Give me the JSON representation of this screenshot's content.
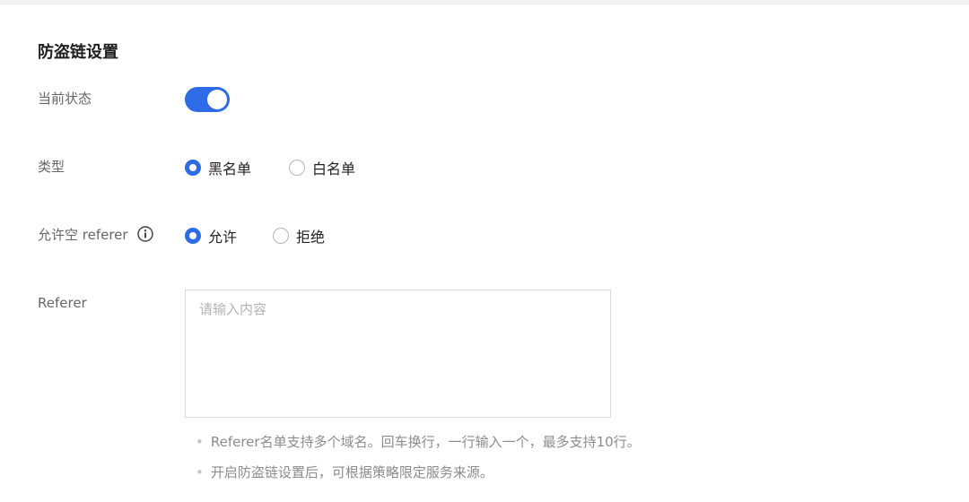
{
  "section": {
    "title": "防盗链设置"
  },
  "status": {
    "label": "当前状态",
    "enabled": true
  },
  "type": {
    "label": "类型",
    "options": [
      {
        "label": "黑名单",
        "checked": true
      },
      {
        "label": "白名单",
        "checked": false
      }
    ]
  },
  "allow_empty": {
    "label": "允许空 referer",
    "info_icon": "info-icon",
    "options": [
      {
        "label": "允许",
        "checked": true
      },
      {
        "label": "拒绝",
        "checked": false
      }
    ]
  },
  "referer": {
    "label": "Referer",
    "value": "",
    "placeholder": "请输入内容"
  },
  "tips": [
    "Referer名单支持多个域名。回车换行，一行输入一个，最多支持10行。",
    "开启防盗链设置后，可根据策略限定服务来源。"
  ],
  "colors": {
    "accent": "#2e6be6",
    "label": "#666666",
    "tip": "#8c8c8c"
  }
}
